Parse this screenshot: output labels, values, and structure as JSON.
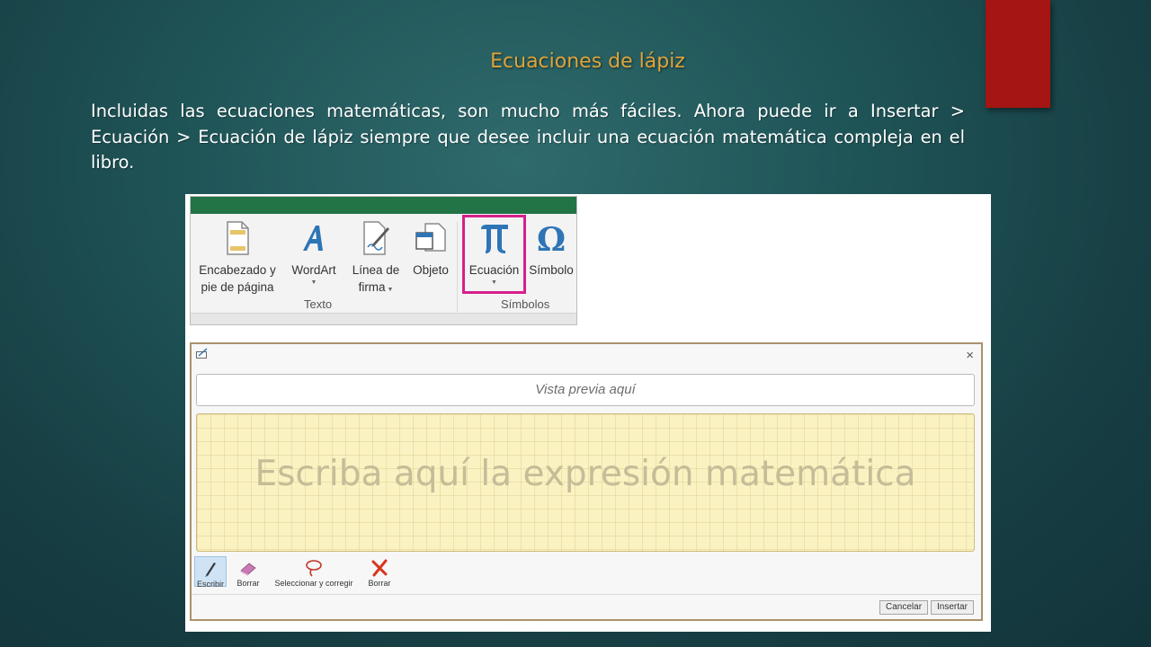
{
  "slide": {
    "title": "Ecuaciones de lápiz",
    "body": "Incluidas las ecuaciones matemáticas, son mucho más fáciles. Ahora puede ir a Insertar > Ecuación > Ecuación de lápiz siempre que desee incluir una ecuación matemática compleja en el libro.",
    "accent_color": "#a51513",
    "title_color": "#e0a43a"
  },
  "ribbon": {
    "bar_color": "#227447",
    "buttons": [
      {
        "line1": "Encabezado y",
        "line2": "pie de página",
        "icon": "header-footer-icon"
      },
      {
        "line1": "WordArt",
        "icon": "wordart-icon"
      },
      {
        "line1": "Línea de",
        "line2": "firma",
        "icon": "signature-line-icon"
      },
      {
        "line1": "Objeto",
        "icon": "object-icon"
      },
      {
        "line1": "Ecuación",
        "icon": "pi-icon"
      },
      {
        "line1": "Símbolo",
        "icon": "omega-icon"
      }
    ],
    "groups": [
      "Texto",
      "Símbolos"
    ],
    "highlight_color": "#d61f8c"
  },
  "dialog": {
    "close_label": "×",
    "preview_placeholder": "Vista previa aquí",
    "ink_hint": "Escriba aquí la expresión matemática",
    "tools": [
      {
        "label": "Escribir",
        "icon": "pen-icon",
        "active": true
      },
      {
        "label": "Borrar",
        "icon": "eraser-icon"
      },
      {
        "label": "Seleccionar y corregir",
        "icon": "lasso-icon"
      },
      {
        "label": "Borrar",
        "icon": "clear-x-icon"
      }
    ],
    "cancel_label": "Cancelar",
    "insert_label": "Insertar"
  }
}
